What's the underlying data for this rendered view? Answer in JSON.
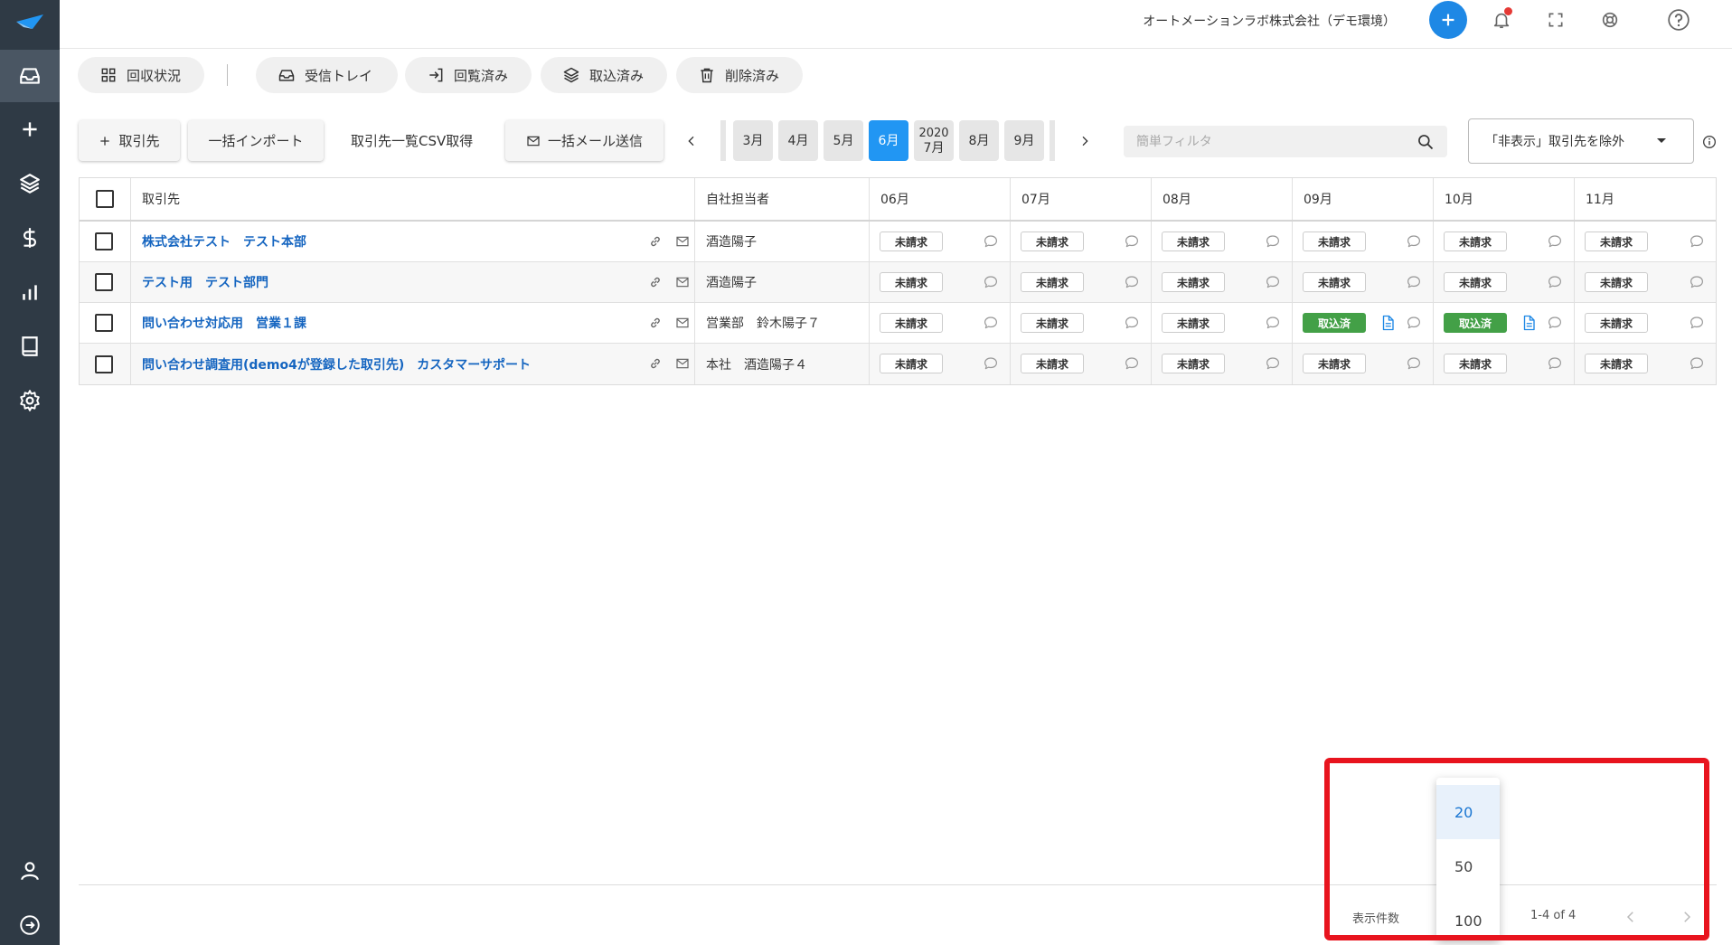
{
  "header": {
    "company": "オートメーションラボ株式会社（デモ環境）"
  },
  "tabs": [
    {
      "label": "回収状況",
      "icon": "grid-icon"
    },
    {
      "label": "受信トレイ",
      "icon": "inbox-icon"
    },
    {
      "label": "回覧済み",
      "icon": "login-arrow-icon"
    },
    {
      "label": "取込済み",
      "icon": "layers-icon"
    },
    {
      "label": "削除済み",
      "icon": "trash-icon"
    }
  ],
  "toolbar": {
    "add_client": "取引先",
    "bulk_import": "一括インポート",
    "csv_export": "取引先一覧CSV取得",
    "bulk_mail": "一括メール送信",
    "months": [
      {
        "label": "3月"
      },
      {
        "label": "4月"
      },
      {
        "label": "5月"
      },
      {
        "label": "6月",
        "selected": true
      },
      {
        "year": "2020",
        "label": "7月"
      },
      {
        "label": "8月"
      },
      {
        "label": "9月"
      }
    ],
    "filter_placeholder": "簡単フィルタ",
    "exclude_label": "「非表示」取引先を除外"
  },
  "table": {
    "headers": {
      "client": "取引先",
      "staff": "自社担当者",
      "months": [
        "06月",
        "07月",
        "08月",
        "09月",
        "10月",
        "11月"
      ]
    },
    "rows": [
      {
        "client": "株式会社テスト　テスト本部",
        "staff": "酒造陽子",
        "statuses": [
          "未請求",
          "未請求",
          "未請求",
          "未請求",
          "未請求",
          "未請求"
        ]
      },
      {
        "client": "テスト用　テスト部門",
        "staff": "酒造陽子",
        "statuses": [
          "未請求",
          "未請求",
          "未請求",
          "未請求",
          "未請求",
          "未請求"
        ]
      },
      {
        "client": "問い合わせ対応用　営業１課",
        "staff": "営業部　鈴木陽子７",
        "statuses": [
          "未請求",
          "未請求",
          "未請求",
          "取込済",
          "取込済",
          "未請求"
        ]
      },
      {
        "client": "問い合わせ調査用(demo4が登録した取引先)　カスタマーサポート",
        "staff": "本社　酒造陽子４",
        "statuses": [
          "未請求",
          "未請求",
          "未請求",
          "未請求",
          "未請求",
          "未請求"
        ]
      }
    ]
  },
  "pagination": {
    "per_page_label": "表示件数",
    "range": "1-4 of 4",
    "options": [
      "20",
      "50",
      "100"
    ],
    "selected": "20"
  },
  "colors": {
    "sidebar": "#2f3a45",
    "accent": "#2196f3",
    "done": "#43a047",
    "highlight": "#e8141e"
  }
}
